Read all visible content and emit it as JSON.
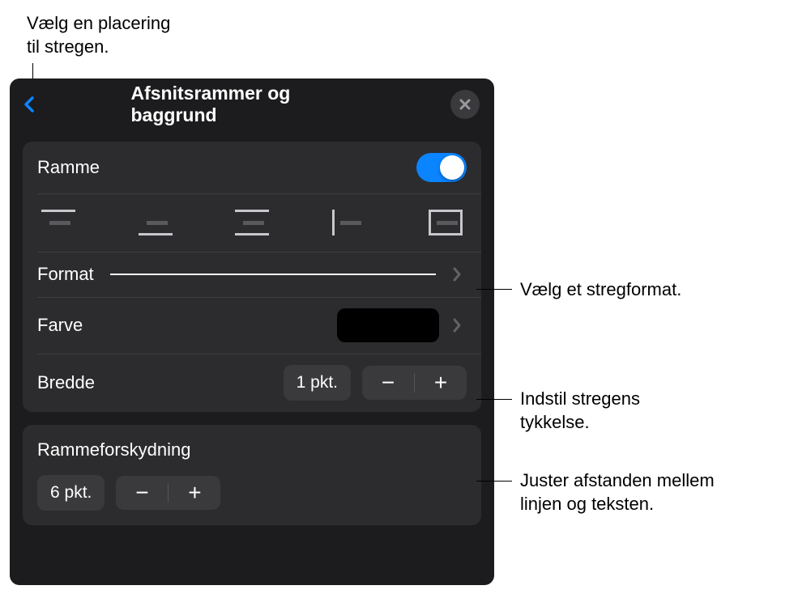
{
  "callouts": {
    "top": "Vælg en placering\ntil stregen.",
    "format": "Vælg et stregformat.",
    "width": "Indstil stregens\ntykkelse.",
    "offset": "Juster afstanden mellem\nlinjen og teksten."
  },
  "panel": {
    "title": "Afsnitsrammer og baggrund"
  },
  "ramme": {
    "label": "Ramme",
    "enabled": true
  },
  "format": {
    "label": "Format"
  },
  "farve": {
    "label": "Farve",
    "color": "#000000"
  },
  "bredde": {
    "label": "Bredde",
    "value": "1 pkt."
  },
  "offset": {
    "label": "Rammeforskydning",
    "value": "6 pkt."
  }
}
